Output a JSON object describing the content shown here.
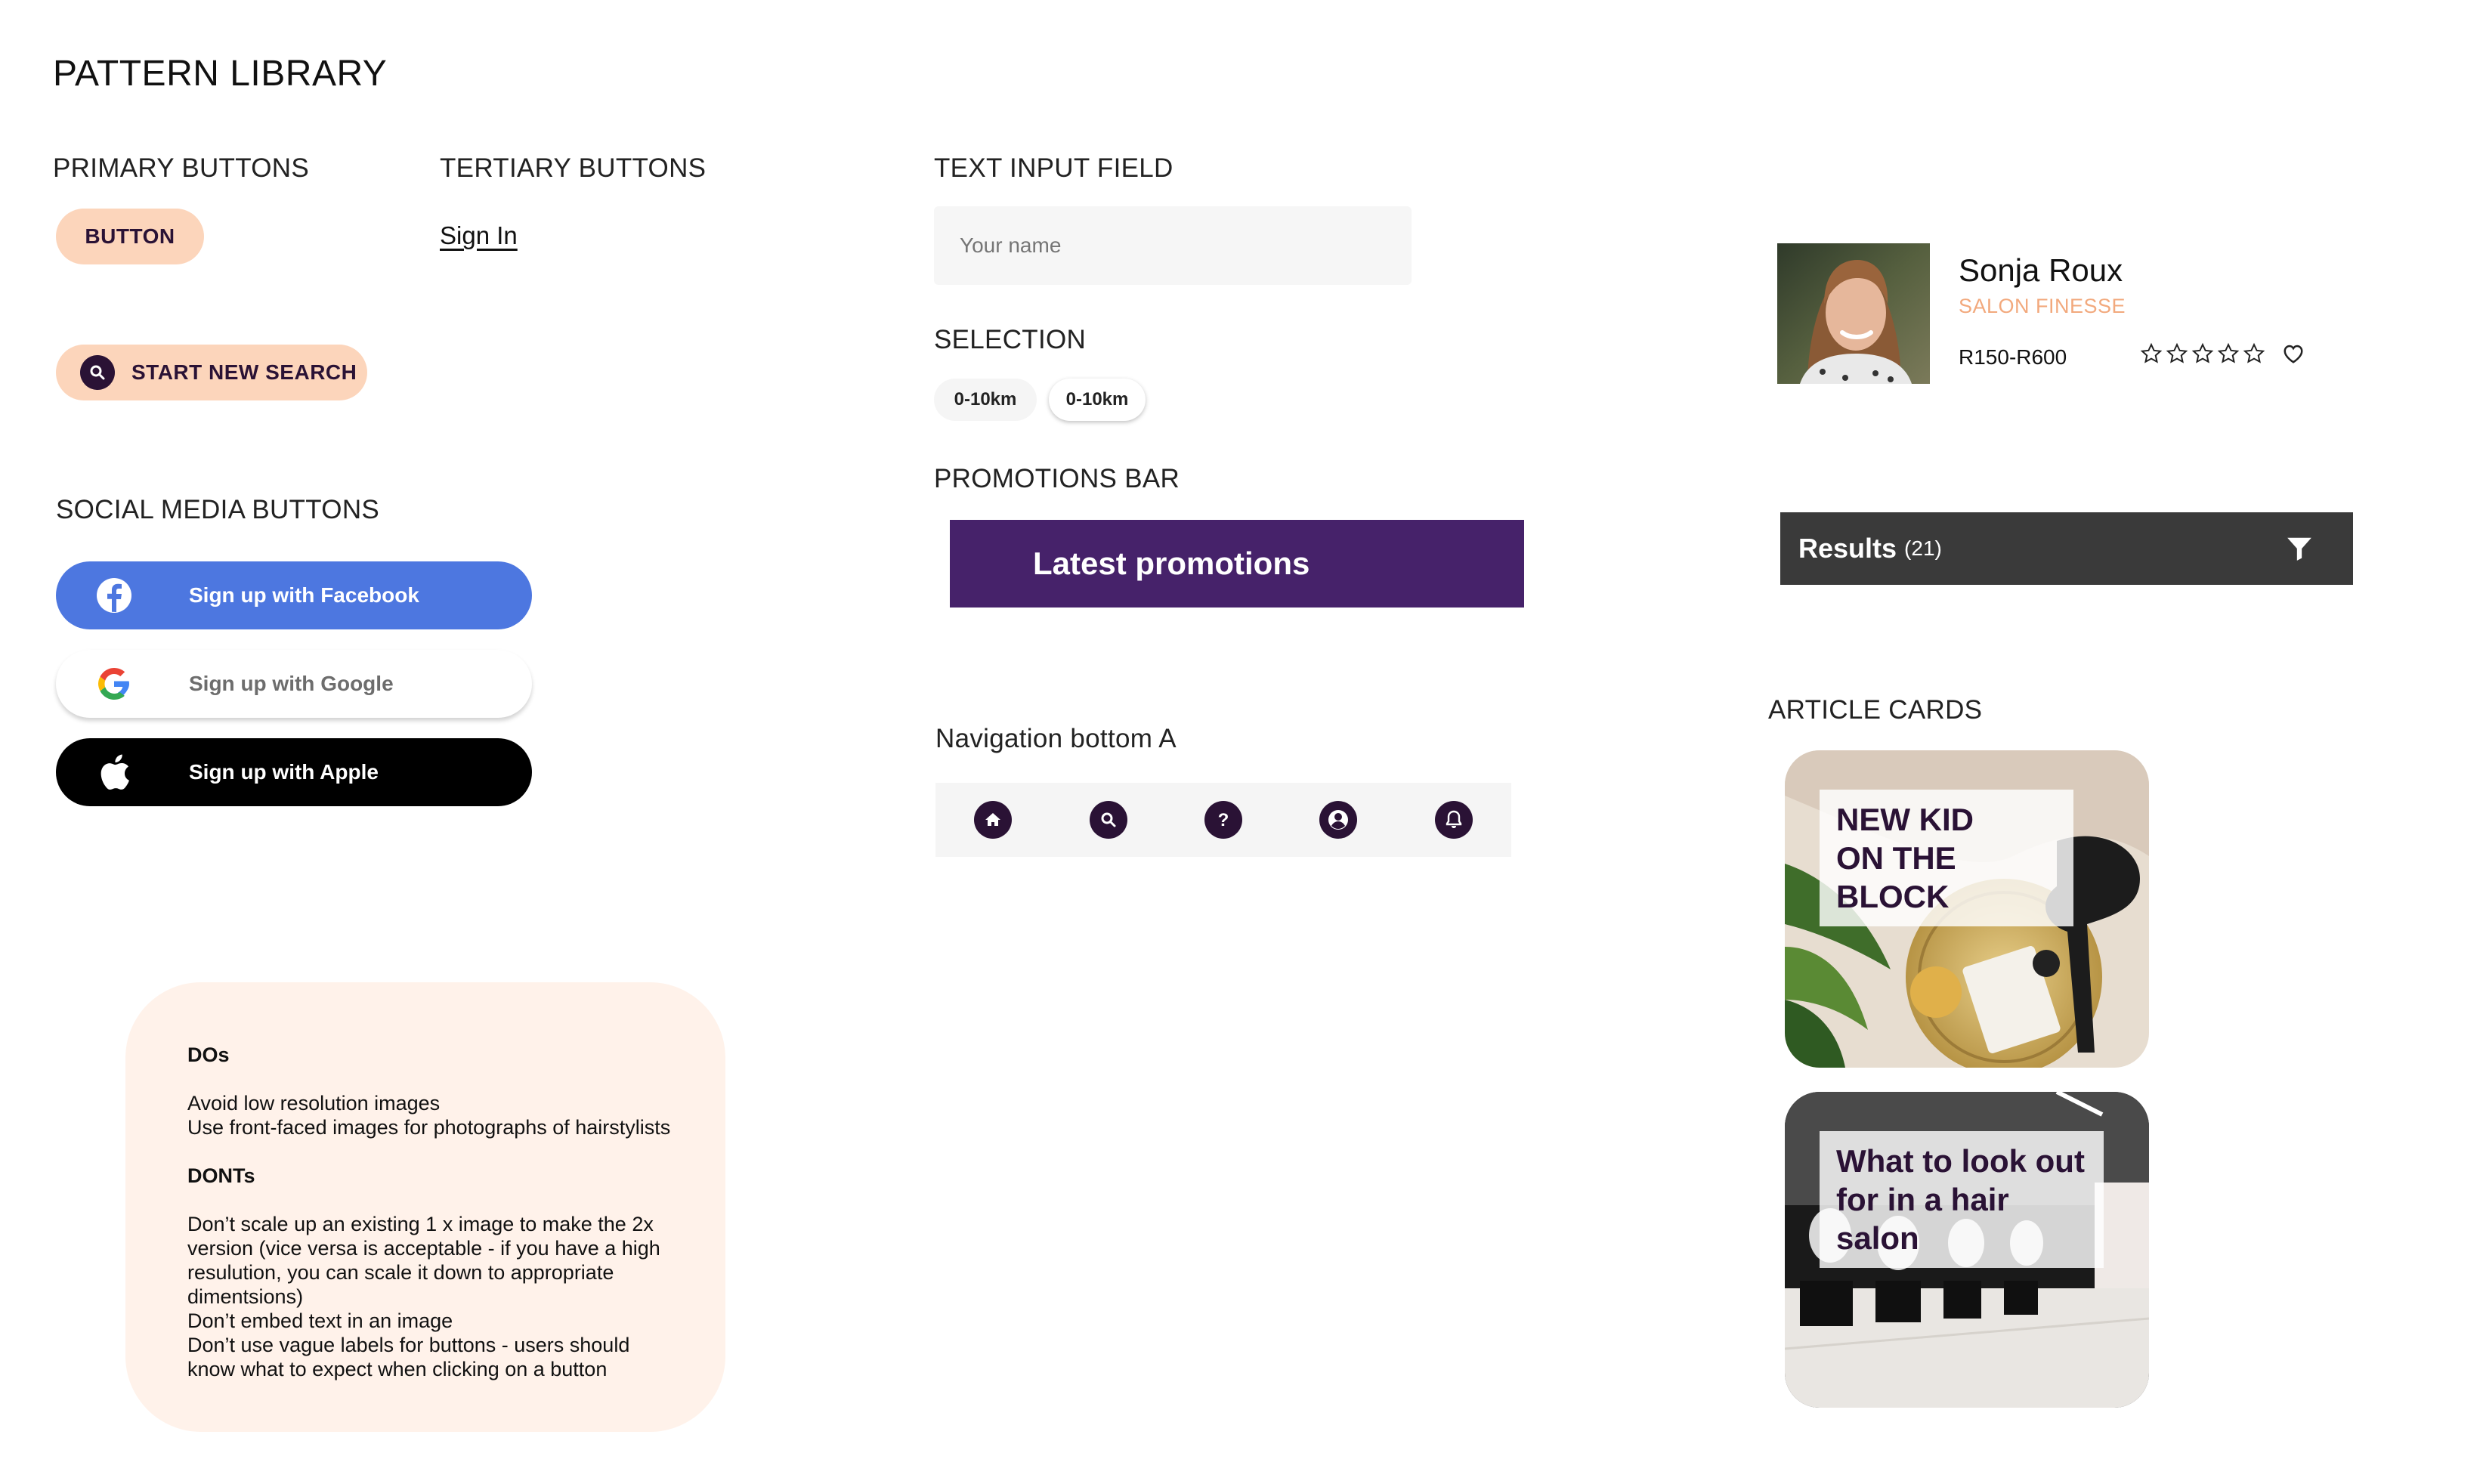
{
  "page": {
    "title": "PATTERN LIBRARY"
  },
  "primary": {
    "heading": "PRIMARY BUTTONS",
    "button_label": "BUTTON",
    "search_label": "START NEW SEARCH",
    "search_icon": "search-icon"
  },
  "tertiary": {
    "heading": "TERTIARY BUTTONS",
    "link_label": "Sign In"
  },
  "social": {
    "heading": "SOCIAL MEDIA BUTTONS",
    "facebook": {
      "label": "Sign up with Facebook",
      "icon": "facebook-icon",
      "color": "#4d77e0"
    },
    "google": {
      "label": "Sign up with Google",
      "icon": "google-icon"
    },
    "apple": {
      "label": "Sign up with Apple",
      "icon": "apple-icon",
      "color": "#000000"
    }
  },
  "input": {
    "heading": "TEXT INPUT FIELD",
    "placeholder": "Your name"
  },
  "selection": {
    "heading": "SELECTION",
    "chips": [
      "0-10km",
      "0-10km"
    ]
  },
  "promotions": {
    "heading": "PROMOTIONS BAR",
    "label": "Latest promotions",
    "color": "#46226a"
  },
  "navigation": {
    "heading": "Navigation bottom A",
    "icons": [
      "home-icon",
      "search-icon",
      "help-icon",
      "account-icon",
      "bell-icon"
    ]
  },
  "guidelines": {
    "dos_title": "DOs",
    "dos": [
      "Avoid low resolution images",
      "Use front-faced images for photographs of hairstylists"
    ],
    "donts_title": "DONTs",
    "donts": [
      "Don’t scale up an existing 1 x image to make the 2x version (vice versa is acceptable - if you have a high resulution, you can scale it down to appropriate dimentsions)",
      "Don’t embed text in an image",
      "Don’t use vague labels for buttons - users should know what to expect when clicking on a button"
    ]
  },
  "profile": {
    "name": "Sonja Roux",
    "salon": "SALON FINESSE",
    "price": "R150-R600",
    "rating": 0,
    "rating_max": 5,
    "accent": "#f2a97d"
  },
  "results": {
    "label": "Results",
    "count": "(21)",
    "icon": "filter-icon"
  },
  "articles": {
    "heading": "ARTICLE CARDS",
    "cards": [
      {
        "line1": "NEW KID",
        "line2": "ON THE BLOCK"
      },
      {
        "line1": "What to look out",
        "line2": "for in a hair salon"
      }
    ]
  },
  "colors": {
    "peach": "#fcd5bb",
    "plum": "#2a1235",
    "note_bg": "#fff2ea",
    "bar_dark": "#3a3a3a"
  }
}
